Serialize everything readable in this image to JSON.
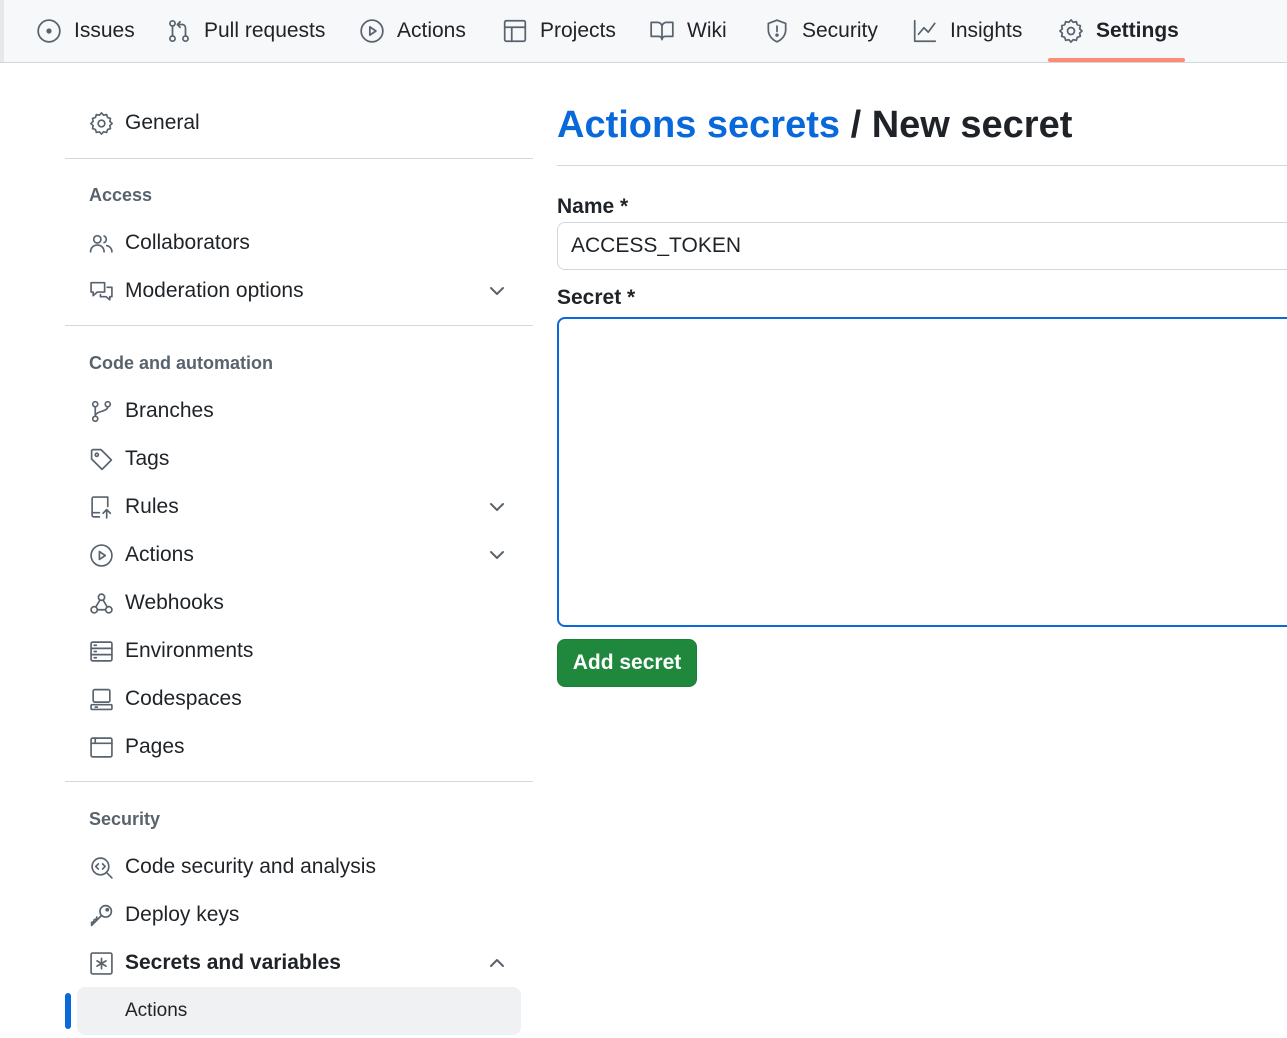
{
  "topnav": {
    "tabs": [
      {
        "label": "Issues",
        "icon": "issue-opened-icon"
      },
      {
        "label": "Pull requests",
        "icon": "git-pull-request-icon"
      },
      {
        "label": "Actions",
        "icon": "play-icon"
      },
      {
        "label": "Projects",
        "icon": "table-icon"
      },
      {
        "label": "Wiki",
        "icon": "book-icon"
      },
      {
        "label": "Security",
        "icon": "shield-icon"
      },
      {
        "label": "Insights",
        "icon": "graph-icon"
      },
      {
        "label": "Settings",
        "icon": "gear-icon",
        "selected": true
      }
    ],
    "selected_underline_color": "#fd8c73"
  },
  "sidebar": {
    "general": "General",
    "groups": {
      "access": {
        "heading": "Access",
        "items": [
          "Collaborators",
          "Moderation options"
        ]
      },
      "code": {
        "heading": "Code and automation",
        "items": [
          "Branches",
          "Tags",
          "Rules",
          "Actions",
          "Webhooks",
          "Environments",
          "Codespaces",
          "Pages"
        ]
      },
      "security": {
        "heading": "Security",
        "items": [
          "Code security and analysis",
          "Deploy keys",
          "Secrets and variables"
        ],
        "sub_items": [
          "Actions"
        ]
      }
    },
    "active_color": "#0969da"
  },
  "main": {
    "breadcrumb_link": "Actions secrets",
    "separator": " / ",
    "title": "New secret",
    "name_label": "Name *",
    "name_value": "ACCESS_TOKEN",
    "secret_label": "Secret *",
    "secret_value": "",
    "submit_label": "Add secret",
    "colors": {
      "link": "#0969da",
      "primary_button": "#1f883d"
    }
  }
}
